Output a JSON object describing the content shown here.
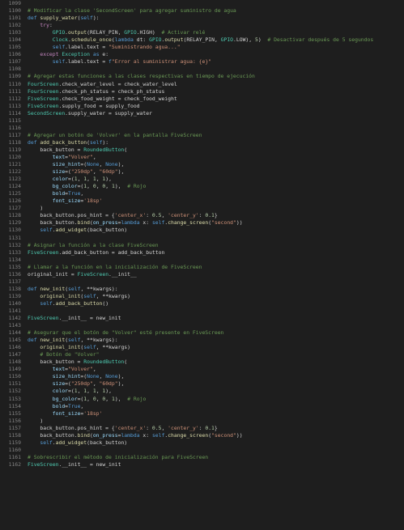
{
  "theme": {
    "background": "#1e1e1e",
    "line_number": "#858585",
    "default": "#d4d4d4",
    "keyword": "#569cd6",
    "control": "#c586c0",
    "function": "#dcdcaa",
    "class": "#4ec9b0",
    "string": "#ce9178",
    "number": "#b5cea8",
    "comment": "#6a9955",
    "variable": "#9cdcfe"
  },
  "lines": [
    {
      "n": "1099",
      "t": ""
    },
    {
      "n": "1100",
      "t": "# Modificar la clase 'SecondScreen' para agregar suministro de agua"
    },
    {
      "n": "1101",
      "t": "def supply_water(self):"
    },
    {
      "n": "1102",
      "t": "    try:"
    },
    {
      "n": "1103",
      "t": "        GPIO.output(RELAY_PIN, GPIO.HIGH)  # Activar relé"
    },
    {
      "n": "1104",
      "t": "        Clock.schedule_once(lambda dt: GPIO.output(RELAY_PIN, GPIO.LOW), 5)  # Desactivar después de 5 segundos"
    },
    {
      "n": "1105",
      "t": "        self.label.text = \"Suministrando agua...\""
    },
    {
      "n": "1106",
      "t": "    except Exception as e:"
    },
    {
      "n": "1107",
      "t": "        self.label.text = f\"Error al suministrar agua: {e}\""
    },
    {
      "n": "1108",
      "t": ""
    },
    {
      "n": "1109",
      "t": "# Agregar estas funciones a las clases respectivas en tiempo de ejecución"
    },
    {
      "n": "1110",
      "t": "FourScreen.check_water_level = check_water_level"
    },
    {
      "n": "1111",
      "t": "FourScreen.check_ph_status = check_ph_status"
    },
    {
      "n": "1112",
      "t": "FiveScreen.check_food_weight = check_food_weight"
    },
    {
      "n": "1113",
      "t": "FiveScreen.supply_food = supply_food"
    },
    {
      "n": "1114",
      "t": "SecondScreen.supply_water = supply_water"
    },
    {
      "n": "1115",
      "t": ""
    },
    {
      "n": "1116",
      "t": ""
    },
    {
      "n": "1117",
      "t": "# Agregar un botón de 'Volver' en la pantalla FiveScreen"
    },
    {
      "n": "1118",
      "t": "def add_back_button(self):"
    },
    {
      "n": "1119",
      "t": "    back_button = RoundedButton("
    },
    {
      "n": "1120",
      "t": "        text=\"Volver\","
    },
    {
      "n": "1121",
      "t": "        size_hint=(None, None),"
    },
    {
      "n": "1122",
      "t": "        size=(\"250dp\", \"60dp\"),"
    },
    {
      "n": "1123",
      "t": "        color=(1, 1, 1, 1),"
    },
    {
      "n": "1124",
      "t": "        bg_color=(1, 0, 0, 1),  # Rojo"
    },
    {
      "n": "1125",
      "t": "        bold=True,"
    },
    {
      "n": "1126",
      "t": "        font_size='18sp'"
    },
    {
      "n": "1127",
      "t": "    )"
    },
    {
      "n": "1128",
      "t": "    back_button.pos_hint = {'center_x': 0.5, 'center_y': 0.1}"
    },
    {
      "n": "1129",
      "t": "    back_button.bind(on_press=lambda x: self.change_screen(\"second\"))"
    },
    {
      "n": "1130",
      "t": "    self.add_widget(back_button)"
    },
    {
      "n": "1131",
      "t": ""
    },
    {
      "n": "1132",
      "t": "# Asignar la función a la clase FiveScreen"
    },
    {
      "n": "1133",
      "t": "FiveScreen.add_back_button = add_back_button"
    },
    {
      "n": "1134",
      "t": ""
    },
    {
      "n": "1135",
      "t": "# Llamar a la función en la inicialización de FiveScreen"
    },
    {
      "n": "1136",
      "t": "original_init = FiveScreen.__init__"
    },
    {
      "n": "1137",
      "t": ""
    },
    {
      "n": "1138",
      "t": "def new_init(self, **kwargs):"
    },
    {
      "n": "1139",
      "t": "    original_init(self, **kwargs)"
    },
    {
      "n": "1140",
      "t": "    self.add_back_button()"
    },
    {
      "n": "1141",
      "t": ""
    },
    {
      "n": "1142",
      "t": "FiveScreen.__init__ = new_init"
    },
    {
      "n": "1143",
      "t": ""
    },
    {
      "n": "1144",
      "t": "# Asegurar que el botón de \"Volver\" esté presente en FiveScreen"
    },
    {
      "n": "1145",
      "t": "def new_init(self, **kwargs):"
    },
    {
      "n": "1146",
      "t": "    original_init(self, **kwargs)"
    },
    {
      "n": "1147",
      "t": "    # Botón de \"Volver\""
    },
    {
      "n": "1148",
      "t": "    back_button = RoundedButton("
    },
    {
      "n": "1149",
      "t": "        text=\"Volver\","
    },
    {
      "n": "1150",
      "t": "        size_hint=(None, None),"
    },
    {
      "n": "1151",
      "t": "        size=(\"250dp\", \"60dp\"),"
    },
    {
      "n": "1152",
      "t": "        color=(1, 1, 1, 1),"
    },
    {
      "n": "1153",
      "t": "        bg_color=(1, 0, 0, 1),  # Rojo"
    },
    {
      "n": "1154",
      "t": "        bold=True,"
    },
    {
      "n": "1155",
      "t": "        font_size='18sp'"
    },
    {
      "n": "1156",
      "t": "    )"
    },
    {
      "n": "1157",
      "t": "    back_button.pos_hint = {'center_x': 0.5, 'center_y': 0.1}"
    },
    {
      "n": "1158",
      "t": "    back_button.bind(on_press=lambda x: self.change_screen(\"second\"))"
    },
    {
      "n": "1159",
      "t": "    self.add_widget(back_button)"
    },
    {
      "n": "1160",
      "t": ""
    },
    {
      "n": "1161",
      "t": "# Sobrescribir el método de inicialización para FiveScreen"
    },
    {
      "n": "1162",
      "t": "FiveScreen.__init__ = new_init"
    }
  ]
}
